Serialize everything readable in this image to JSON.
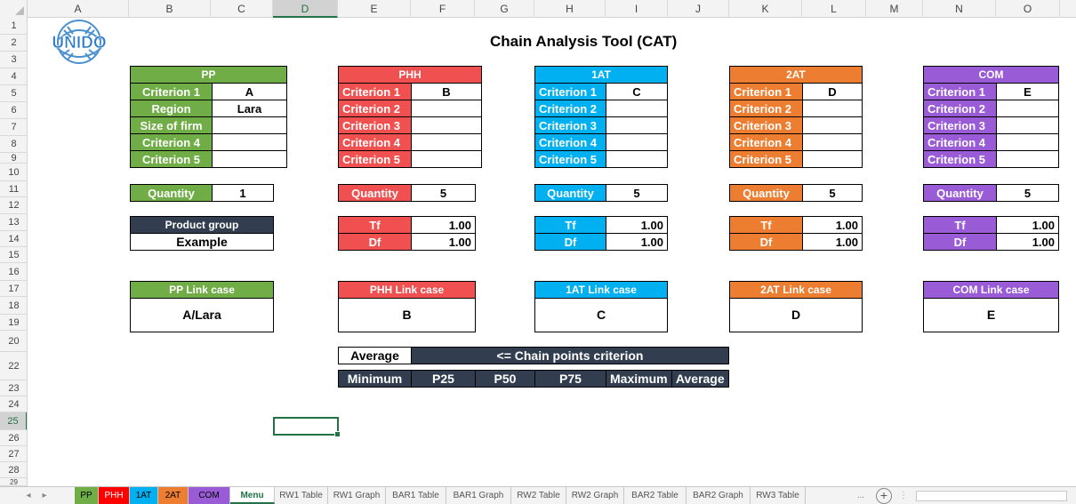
{
  "sheet": {
    "title": "Chain Analysis Tool (CAT)",
    "logo_text": "UNIDO",
    "columns": [
      "A",
      "B",
      "C",
      "D",
      "E",
      "F",
      "G",
      "H",
      "I",
      "J",
      "K",
      "L",
      "M",
      "N",
      "O"
    ],
    "rows": [
      "1",
      "2",
      "3",
      "4",
      "5",
      "6",
      "7",
      "8",
      "9",
      "10",
      "11",
      "12",
      "13",
      "14",
      "15",
      "16",
      "17",
      "18",
      "19",
      "20",
      "22",
      "23",
      "24",
      "25",
      "26",
      "27",
      "28",
      "29"
    ]
  },
  "pp": {
    "header": "PP",
    "rows": [
      {
        "label": "Criterion 1",
        "value": "A"
      },
      {
        "label": "Region",
        "value": "Lara"
      },
      {
        "label": "Size of firm",
        "value": ""
      },
      {
        "label": "Criterion 4",
        "value": ""
      },
      {
        "label": "Criterion 5",
        "value": ""
      }
    ],
    "quantity_label": "Quantity",
    "quantity_value": "1",
    "product_group_label": "Product group",
    "product_group_value": "Example",
    "link_label": "PP Link case",
    "link_value": "A/Lara"
  },
  "phh": {
    "header": "PHH",
    "rows": [
      {
        "label": "Criterion 1",
        "value": "B"
      },
      {
        "label": "Criterion 2",
        "value": ""
      },
      {
        "label": "Criterion 3",
        "value": ""
      },
      {
        "label": "Criterion 4",
        "value": ""
      },
      {
        "label": "Criterion 5",
        "value": ""
      }
    ],
    "quantity_label": "Quantity",
    "quantity_value": "5",
    "tf_label": "Tf",
    "tf_value": "1.00",
    "df_label": "Df",
    "df_value": "1.00",
    "link_label": "PHH Link case",
    "link_value": "B"
  },
  "at1": {
    "header": "1AT",
    "rows": [
      {
        "label": "Criterion 1",
        "value": "C"
      },
      {
        "label": "Criterion 2",
        "value": ""
      },
      {
        "label": "Criterion 3",
        "value": ""
      },
      {
        "label": "Criterion 4",
        "value": ""
      },
      {
        "label": "Criterion 5",
        "value": ""
      }
    ],
    "quantity_label": "Quantity",
    "quantity_value": "5",
    "tf_label": "Tf",
    "tf_value": "1.00",
    "df_label": "Df",
    "df_value": "1.00",
    "link_label": "1AT Link case",
    "link_value": "C"
  },
  "at2": {
    "header": "2AT",
    "rows": [
      {
        "label": "Criterion 1",
        "value": "D"
      },
      {
        "label": "Criterion 2",
        "value": ""
      },
      {
        "label": "Criterion 3",
        "value": ""
      },
      {
        "label": "Criterion 4",
        "value": ""
      },
      {
        "label": "Criterion 5",
        "value": ""
      }
    ],
    "quantity_label": "Quantity",
    "quantity_value": "5",
    "tf_label": "Tf",
    "tf_value": "1.00",
    "df_label": "Df",
    "df_value": "1.00",
    "link_label": "2AT Link case",
    "link_value": "D"
  },
  "com": {
    "header": "COM",
    "rows": [
      {
        "label": "Criterion 1",
        "value": "E"
      },
      {
        "label": "Criterion 2",
        "value": ""
      },
      {
        "label": "Criterion 3",
        "value": ""
      },
      {
        "label": "Criterion 4",
        "value": ""
      },
      {
        "label": "Criterion 5",
        "value": ""
      }
    ],
    "quantity_label": "Quantity",
    "quantity_value": "5",
    "tf_label": "Tf",
    "tf_value": "1.00",
    "df_label": "Df",
    "df_value": "1.00",
    "link_label": "COM Link case",
    "link_value": "E"
  },
  "chain_points": {
    "selected": "Average",
    "caption": "<= Chain points criterion",
    "options": [
      "Minimum",
      "P25",
      "P50",
      "P75",
      "Maximum",
      "Average"
    ]
  },
  "tabs": {
    "prev_icon": "◂",
    "next_icon": "▸",
    "items": [
      "PP",
      "PHH",
      "1AT",
      "2AT",
      "COM",
      "Menu",
      "RW1 Table",
      "RW1 Graph",
      "BAR1 Table",
      "BAR1 Graph",
      "RW2 Table",
      "RW2 Graph",
      "BAR2 Table",
      "BAR2 Graph",
      "RW3 Table"
    ],
    "more": "...",
    "add": "+",
    "menu": "⋮"
  },
  "colors": {
    "pp": "#70ad47",
    "phh": "#f0504f",
    "at1": "#00b0f0",
    "at2": "#ed7d31",
    "com": "#9a5bd6",
    "navy": "#323e4f",
    "excel_green": "#217346"
  }
}
